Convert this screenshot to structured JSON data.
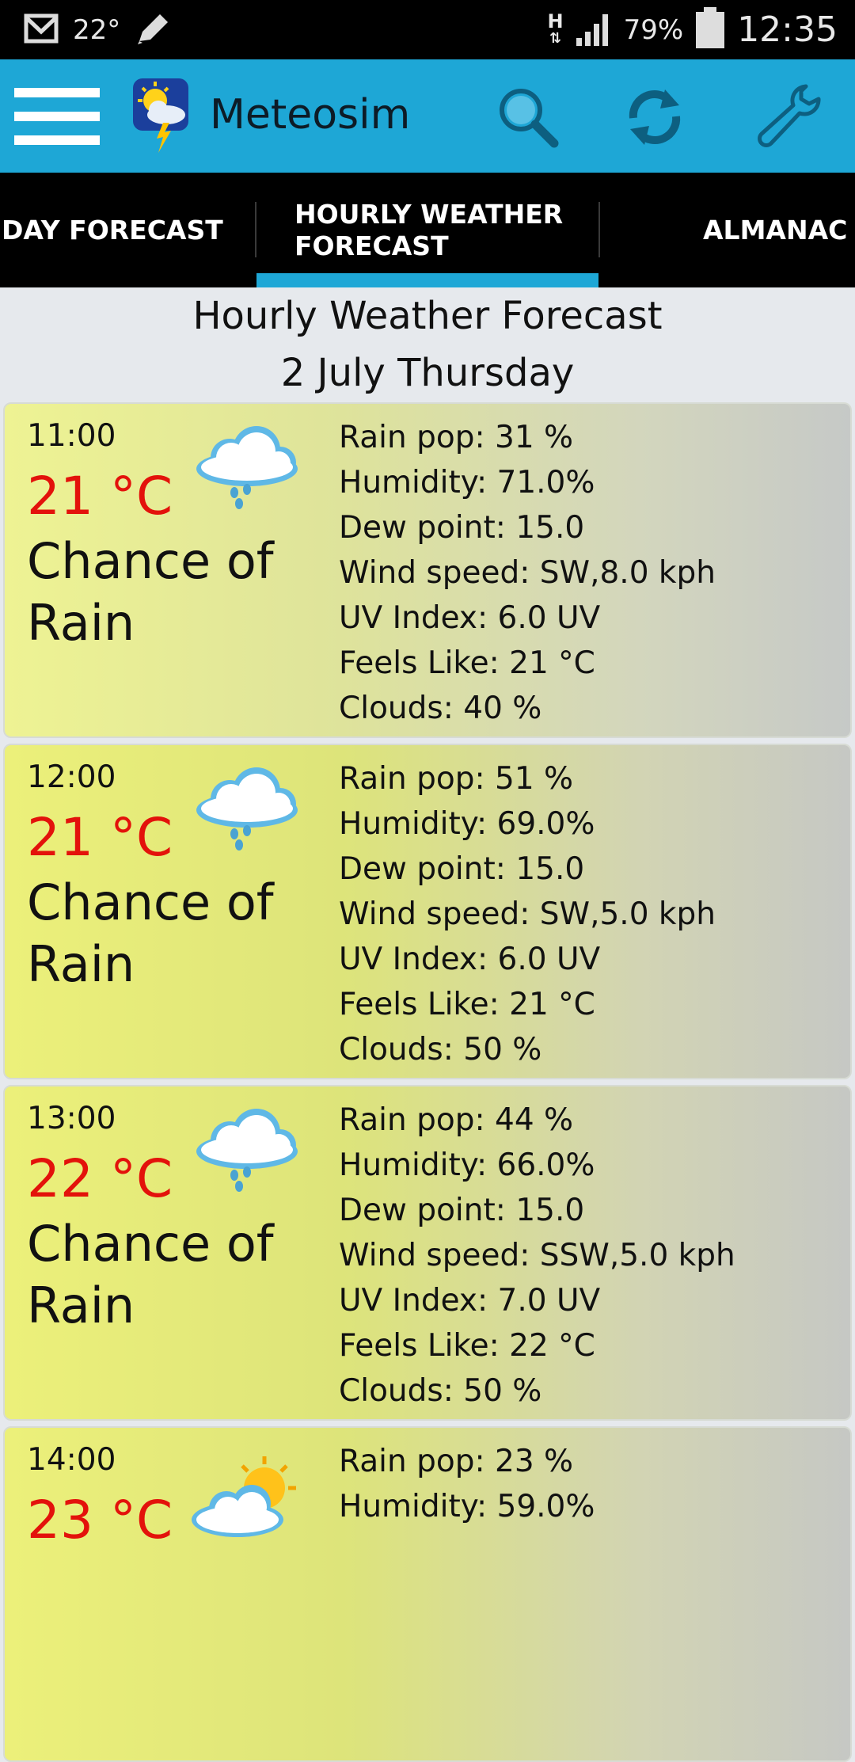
{
  "status_bar": {
    "temperature": "22°",
    "network_label": "H",
    "battery_percent": "79%",
    "time": "12:35"
  },
  "app_bar": {
    "title": "Meteosim",
    "icons": [
      "menu-icon",
      "app-logo",
      "search-icon",
      "refresh-icon",
      "settings-wrench-icon"
    ]
  },
  "tabs": [
    {
      "label": "DAY FORECAST",
      "selected": false
    },
    {
      "label": "HOURLY WEATHER FORECAST",
      "line1": "HOURLY WEATHER",
      "line2": "FORECAST",
      "selected": true
    },
    {
      "label": "ALMANAC",
      "selected": false
    }
  ],
  "header": {
    "title": "Hourly Weather Forecast",
    "date": "2 July Thursday"
  },
  "colors": {
    "app_bar": "#1ea7d6",
    "temperature": "#e3120b",
    "tab_indicator": "#1ea7d6"
  },
  "forecasts": [
    {
      "time": "11:00",
      "temp": "21 °C",
      "condition": "Chance of Rain",
      "icon": "rain-cloud-icon",
      "rain_pop": "Rain pop: 31 %",
      "humidity": "Humidity: 71.0%",
      "dew_point": "Dew point: 15.0",
      "wind": "Wind speed: SW,8.0 kph",
      "uv": "UV Index: 6.0 UV",
      "feels_like": "Feels Like: 21 °C",
      "clouds": "Clouds: 40 %"
    },
    {
      "time": "12:00",
      "temp": "21 °C",
      "condition": "Chance of Rain",
      "icon": "rain-cloud-icon",
      "rain_pop": "Rain pop: 51 %",
      "humidity": "Humidity: 69.0%",
      "dew_point": "Dew point: 15.0",
      "wind": "Wind speed: SW,5.0 kph",
      "uv": "UV Index: 6.0 UV",
      "feels_like": "Feels Like: 21 °C",
      "clouds": "Clouds: 50 %"
    },
    {
      "time": "13:00",
      "temp": "22 °C",
      "condition": "Chance of Rain",
      "icon": "rain-cloud-icon",
      "rain_pop": "Rain pop: 44 %",
      "humidity": "Humidity: 66.0%",
      "dew_point": "Dew point: 15.0",
      "wind": "Wind speed: SSW,5.0 kph",
      "uv": "UV Index: 7.0 UV",
      "feels_like": "Feels Like: 22 °C",
      "clouds": "Clouds: 50 %"
    },
    {
      "time": "14:00",
      "temp": "23 °C",
      "condition": "",
      "icon": "sun-cloud-icon",
      "rain_pop": "Rain pop: 23 %",
      "humidity": "Humidity: 59.0%",
      "dew_point": "",
      "wind": "",
      "uv": "",
      "feels_like": "",
      "clouds": ""
    }
  ]
}
